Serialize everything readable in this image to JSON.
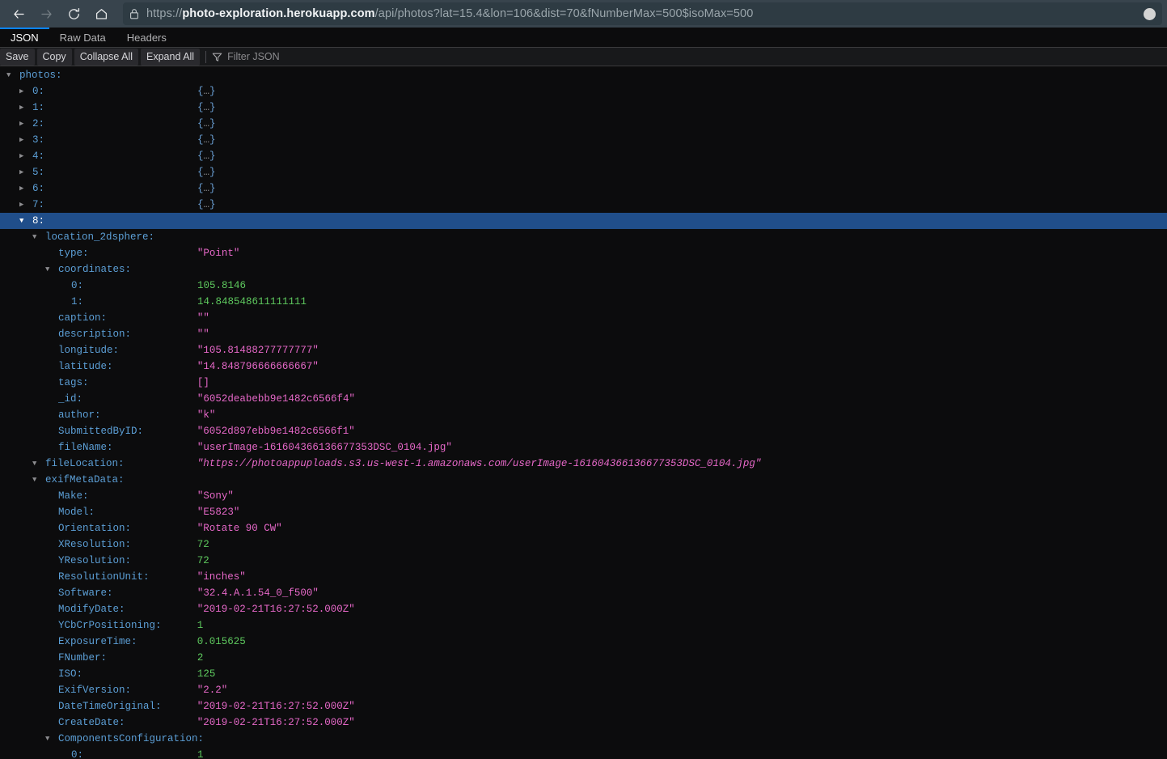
{
  "browser": {
    "nav": {
      "back_icon": "arrow-left-icon",
      "forward_icon": "arrow-right-icon",
      "reload_icon": "reload-icon",
      "home_icon": "home-icon"
    },
    "url_bar": {
      "lock_icon": "lock-icon",
      "scheme": "https://",
      "host": "photo-exploration.herokuapp.com",
      "path": "/api/photos?lat=15.4&lon=106&dist=70&fNumberMax=500$isoMax=500",
      "full_url": "https://photo-exploration.herokuapp.com/api/photos?lat=15.4&lon=106&dist=70&fNumberMax=500$isoMax=500",
      "identity_circle": "account-circle-icon"
    }
  },
  "viewer": {
    "tabs": [
      {
        "label": "JSON",
        "active": true
      },
      {
        "label": "Raw Data",
        "active": false
      },
      {
        "label": "Headers",
        "active": false
      }
    ],
    "toolbar": {
      "save_label": "Save",
      "copy_label": "Copy",
      "collapse_all_label": "Collapse All",
      "expand_all_label": "Expand All",
      "filter_icon": "filter-icon",
      "filter_placeholder": "Filter JSON",
      "filter_value": ""
    },
    "accent_color": "#0a84ff",
    "selection_color": "#204e8a",
    "colors": {
      "key": "#5c9fd6",
      "string": "#e668c8",
      "number": "#5ec95e",
      "background": "#0c0c0d"
    }
  },
  "json_tree": [
    {
      "indent": 0,
      "twisty": "down",
      "key": "photos:",
      "value": "",
      "type": "none",
      "selected": false
    },
    {
      "indent": 1,
      "twisty": "right",
      "key": "0:",
      "value": "{…}",
      "type": "obj",
      "selected": false
    },
    {
      "indent": 1,
      "twisty": "right",
      "key": "1:",
      "value": "{…}",
      "type": "obj",
      "selected": false
    },
    {
      "indent": 1,
      "twisty": "right",
      "key": "2:",
      "value": "{…}",
      "type": "obj",
      "selected": false
    },
    {
      "indent": 1,
      "twisty": "right",
      "key": "3:",
      "value": "{…}",
      "type": "obj",
      "selected": false
    },
    {
      "indent": 1,
      "twisty": "right",
      "key": "4:",
      "value": "{…}",
      "type": "obj",
      "selected": false
    },
    {
      "indent": 1,
      "twisty": "right",
      "key": "5:",
      "value": "{…}",
      "type": "obj",
      "selected": false
    },
    {
      "indent": 1,
      "twisty": "right",
      "key": "6:",
      "value": "{…}",
      "type": "obj",
      "selected": false
    },
    {
      "indent": 1,
      "twisty": "right",
      "key": "7:",
      "value": "{…}",
      "type": "obj",
      "selected": false
    },
    {
      "indent": 1,
      "twisty": "down",
      "key": "8:",
      "value": "",
      "type": "none",
      "selected": true
    },
    {
      "indent": 2,
      "twisty": "down",
      "key": "location_2dsphere:",
      "value": "",
      "type": "none",
      "selected": false
    },
    {
      "indent": 3,
      "twisty": "none",
      "key": "type:",
      "value": "\"Point\"",
      "type": "string",
      "selected": false
    },
    {
      "indent": 3,
      "twisty": "down",
      "key": "coordinates:",
      "value": "",
      "type": "none",
      "selected": false
    },
    {
      "indent": 4,
      "twisty": "none",
      "key": "0:",
      "value": "105.8146",
      "type": "number",
      "selected": false
    },
    {
      "indent": 4,
      "twisty": "none",
      "key": "1:",
      "value": "14.848548611111111",
      "type": "number",
      "selected": false
    },
    {
      "indent": 3,
      "twisty": "none",
      "key": "caption:",
      "value": "\"\"",
      "type": "string",
      "selected": false
    },
    {
      "indent": 3,
      "twisty": "none",
      "key": "description:",
      "value": "\"\"",
      "type": "string",
      "selected": false
    },
    {
      "indent": 3,
      "twisty": "none",
      "key": "longitude:",
      "value": "\"105.81488277777777\"",
      "type": "string",
      "selected": false
    },
    {
      "indent": 3,
      "twisty": "none",
      "key": "latitude:",
      "value": "\"14.848796666666667\"",
      "type": "string",
      "selected": false
    },
    {
      "indent": 3,
      "twisty": "none",
      "key": "tags:",
      "value": "[]",
      "type": "string",
      "selected": false
    },
    {
      "indent": 3,
      "twisty": "none",
      "key": "_id:",
      "value": "\"6052deabebb9e1482c6566f4\"",
      "type": "string",
      "selected": false
    },
    {
      "indent": 3,
      "twisty": "none",
      "key": "author:",
      "value": "\"k\"",
      "type": "string",
      "selected": false
    },
    {
      "indent": 3,
      "twisty": "none",
      "key": "SubmittedByID:",
      "value": "\"6052d897ebb9e1482c6566f1\"",
      "type": "string",
      "selected": false
    },
    {
      "indent": 3,
      "twisty": "none",
      "key": "fileName:",
      "value": "\"userImage-161604366136677353DSC_0104.jpg\"",
      "type": "string",
      "selected": false
    },
    {
      "indent": 2,
      "twisty": "down",
      "key": "fileLocation:",
      "value": "\"https://photoappuploads.s3.us-west-1.amazonaws.com/userImage-161604366136677353DSC_0104.jpg\"",
      "type": "url",
      "selected": false
    },
    {
      "indent": 2,
      "twisty": "down",
      "key": "exifMetaData:",
      "value": "",
      "type": "none",
      "selected": false
    },
    {
      "indent": 3,
      "twisty": "none",
      "key": "Make:",
      "value": "\"Sony\"",
      "type": "string",
      "selected": false
    },
    {
      "indent": 3,
      "twisty": "none",
      "key": "Model:",
      "value": "\"E5823\"",
      "type": "string",
      "selected": false
    },
    {
      "indent": 3,
      "twisty": "none",
      "key": "Orientation:",
      "value": "\"Rotate 90 CW\"",
      "type": "string",
      "selected": false
    },
    {
      "indent": 3,
      "twisty": "none",
      "key": "XResolution:",
      "value": "72",
      "type": "number",
      "selected": false
    },
    {
      "indent": 3,
      "twisty": "none",
      "key": "YResolution:",
      "value": "72",
      "type": "number",
      "selected": false
    },
    {
      "indent": 3,
      "twisty": "none",
      "key": "ResolutionUnit:",
      "value": "\"inches\"",
      "type": "string",
      "selected": false
    },
    {
      "indent": 3,
      "twisty": "none",
      "key": "Software:",
      "value": "\"32.4.A.1.54_0_f500\"",
      "type": "string",
      "selected": false
    },
    {
      "indent": 3,
      "twisty": "none",
      "key": "ModifyDate:",
      "value": "\"2019-02-21T16:27:52.000Z\"",
      "type": "string",
      "selected": false
    },
    {
      "indent": 3,
      "twisty": "none",
      "key": "YCbCrPositioning:",
      "value": "1",
      "type": "number",
      "selected": false
    },
    {
      "indent": 3,
      "twisty": "none",
      "key": "ExposureTime:",
      "value": "0.015625",
      "type": "number",
      "selected": false
    },
    {
      "indent": 3,
      "twisty": "none",
      "key": "FNumber:",
      "value": "2",
      "type": "number",
      "selected": false
    },
    {
      "indent": 3,
      "twisty": "none",
      "key": "ISO:",
      "value": "125",
      "type": "number",
      "selected": false
    },
    {
      "indent": 3,
      "twisty": "none",
      "key": "ExifVersion:",
      "value": "\"2.2\"",
      "type": "string",
      "selected": false
    },
    {
      "indent": 3,
      "twisty": "none",
      "key": "DateTimeOriginal:",
      "value": "\"2019-02-21T16:27:52.000Z\"",
      "type": "string",
      "selected": false
    },
    {
      "indent": 3,
      "twisty": "none",
      "key": "CreateDate:",
      "value": "\"2019-02-21T16:27:52.000Z\"",
      "type": "string",
      "selected": false
    },
    {
      "indent": 3,
      "twisty": "down",
      "key": "ComponentsConfiguration:",
      "value": "",
      "type": "none",
      "selected": false
    },
    {
      "indent": 4,
      "twisty": "none",
      "key": "0:",
      "value": "1",
      "type": "number",
      "selected": false
    }
  ]
}
